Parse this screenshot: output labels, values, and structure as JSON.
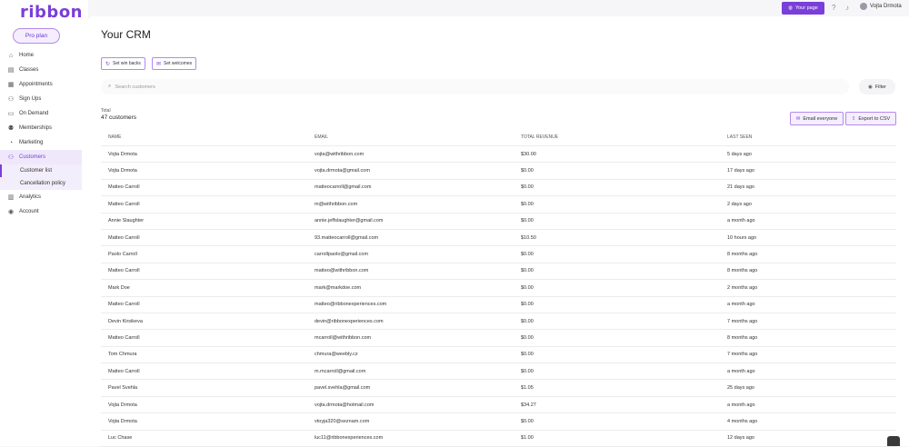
{
  "app": {
    "logo": "ribbon",
    "plan_label": "Pro plan"
  },
  "topbar": {
    "your_page_label": "Your page",
    "help_icon": "help-icon",
    "bell_icon": "bell-icon",
    "user_name": "Vojta Drmota"
  },
  "sidebar": {
    "items": [
      {
        "label": "Home",
        "icon": "home-icon",
        "glyph": "⌂"
      },
      {
        "label": "Classes",
        "icon": "calendar-icon",
        "glyph": "▤"
      },
      {
        "label": "Appointments",
        "icon": "appointment-icon",
        "glyph": "▦"
      },
      {
        "label": "Sign Ups",
        "icon": "users-icon",
        "glyph": "⚇"
      },
      {
        "label": "On Demand",
        "icon": "video-icon",
        "glyph": "▭"
      },
      {
        "label": "Memberships",
        "icon": "members-icon",
        "glyph": "⚉"
      },
      {
        "label": "Marketing",
        "icon": "megaphone-icon",
        "glyph": "◔"
      },
      {
        "label": "Customers",
        "icon": "customers-icon",
        "glyph": "⚇"
      },
      {
        "label": "Analytics",
        "icon": "analytics-icon",
        "glyph": "▥"
      },
      {
        "label": "Account",
        "icon": "account-icon",
        "glyph": "◉"
      }
    ],
    "sub_items": [
      {
        "label": "Customer list"
      },
      {
        "label": "Cancellation policy"
      }
    ]
  },
  "main": {
    "title": "Your CRM",
    "buttons": {
      "win_backs": "Set win backs",
      "welcomes": "Set welcomes"
    },
    "search_placeholder": "Search customers",
    "filter_label": "Filter",
    "total_label": "Total",
    "total_count": "47 customers",
    "email_everyone": "Email everyone",
    "export_csv": "Export to CSV"
  },
  "table": {
    "headers": [
      "NAME",
      "EMAIL",
      "TOTAL REVENUE",
      "LAST SEEN"
    ],
    "rows": [
      [
        "Vojta Drmota",
        "vojta@withribbon.com",
        "$30.00",
        "5 days ago"
      ],
      [
        "Vojta Drmota",
        "vojta.drmota@gmail.com",
        "$0.00",
        "17 days ago"
      ],
      [
        "Matteo Carroll",
        "matteocarroll@gmail.com",
        "$0.00",
        "21 days ago"
      ],
      [
        "Matteo Carroll",
        "m@withribbon.com",
        "$0.00",
        "2 days ago"
      ],
      [
        "Annie Slaughter",
        "annie.jeffslaughter@gmail.com",
        "$0.00",
        "a month ago"
      ],
      [
        "Matteo Carroll",
        "93.matteocarroll@gmail.com",
        "$10.50",
        "10 hours ago"
      ],
      [
        "Paolo Carroll",
        "carrollpaolo@gmail.com",
        "$0.00",
        "8 months ago"
      ],
      [
        "Matteo Carroll",
        "matteo@withribbon.com",
        "$0.00",
        "8 months ago"
      ],
      [
        "Mark Doe",
        "mark@markdoe.com",
        "$0.00",
        "2 months ago"
      ],
      [
        "Matteo Carroll",
        "matteo@ribbonexperiences.com",
        "$0.00",
        "a month ago"
      ],
      [
        "Devin Kirsikeva",
        "devin@ribbonexperiences.com",
        "$0.00",
        "7 months ago"
      ],
      [
        "Matteo Carroll",
        "mcarroll@withribbon.com",
        "$0.00",
        "8 months ago"
      ],
      [
        "Tom Chmura",
        "chmura@weebly.cz",
        "$0.00",
        "7 months ago"
      ],
      [
        "Matteo Carroll",
        "m.mcarroll@gmail.com",
        "$0.00",
        "a month ago"
      ],
      [
        "Pavel Svehla",
        "pavel.svehla@gmail.com",
        "$1.05",
        "25 days ago"
      ],
      [
        "Vojta Drmota",
        "vojta.drmota@hotmail.com",
        "$34.27",
        "a month ago"
      ],
      [
        "Vojta Drmota",
        "vtoyja320@seznam.com",
        "$0.00",
        "4 months ago"
      ],
      [
        "Luc Chase",
        "luc11@ribbonexperiences.com",
        "$1.00",
        "12 days ago"
      ]
    ]
  }
}
